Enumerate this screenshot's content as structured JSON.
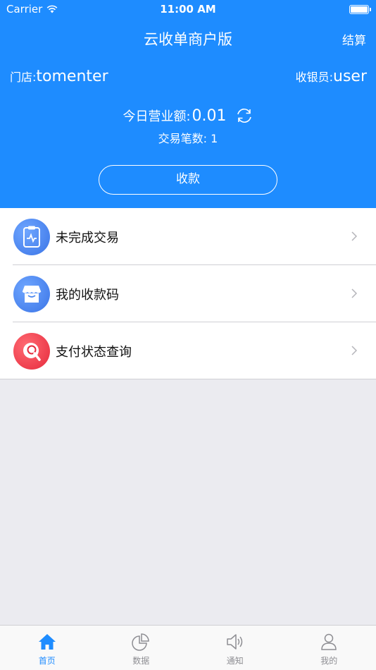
{
  "status_bar": {
    "carrier": "Carrier",
    "time": "11:00 AM"
  },
  "nav": {
    "title": "云收单商户版",
    "settle_label": "结算"
  },
  "info": {
    "store_label": "门店:",
    "store_value": "tomenter",
    "cashier_label": "收银员:",
    "cashier_value": "user"
  },
  "summary": {
    "revenue_label": "今日营业额:",
    "revenue_value": "0.01",
    "count_label": "交易笔数:",
    "count_value": "1"
  },
  "collect_button": "收款",
  "menu": [
    {
      "label": "未完成交易",
      "icon": "clipboard-pulse-icon",
      "color": "#4a86f0"
    },
    {
      "label": "我的收款码",
      "icon": "store-icon",
      "color": "#4a86f0"
    },
    {
      "label": "支付状态查询",
      "icon": "search-q-icon",
      "color": "#f0384a"
    }
  ],
  "tabs": [
    {
      "label": "首页",
      "icon": "home-icon",
      "active": true
    },
    {
      "label": "数据",
      "icon": "pie-chart-icon",
      "active": false
    },
    {
      "label": "通知",
      "icon": "speaker-icon",
      "active": false
    },
    {
      "label": "我的",
      "icon": "person-icon",
      "active": false
    }
  ],
  "colors": {
    "primary": "#1e8cff",
    "background": "#ebebf0",
    "inactive": "#8e8e93"
  }
}
